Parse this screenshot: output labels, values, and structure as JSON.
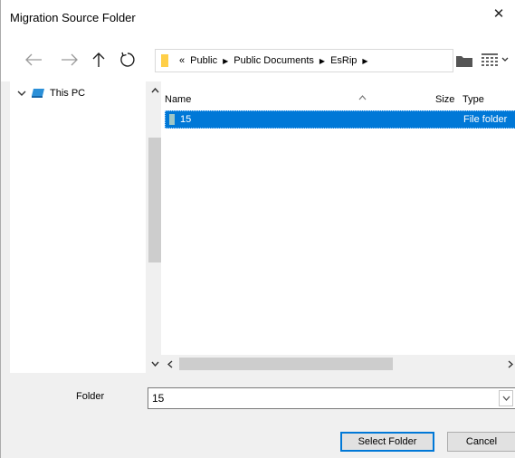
{
  "window": {
    "title": "Migration Source Folder",
    "close_glyph": "✕"
  },
  "nav": {
    "back_icon": "arrow-left-icon",
    "forward_icon": "arrow-right-icon",
    "up_icon": "arrow-up-icon",
    "refresh_icon": "refresh-icon"
  },
  "address": {
    "overflow_glyph": "«",
    "crumbs": [
      "Public",
      "Public Documents",
      "EsRip"
    ],
    "separator": "▶"
  },
  "tree": {
    "items": [
      {
        "label": "This PC",
        "expanded": true
      }
    ]
  },
  "file_list": {
    "columns": {
      "name": "Name",
      "size": "Size",
      "type": "Type"
    },
    "rows": [
      {
        "name": "15",
        "size": "",
        "type": "File folder",
        "selected": true
      }
    ]
  },
  "folder_field": {
    "label": "Folder",
    "value": "15"
  },
  "buttons": {
    "select": "Select Folder",
    "cancel": "Cancel"
  },
  "colors": {
    "accent": "#0078d7",
    "folder_yellow": "#ffcf48",
    "scroll_thumb": "#cdcdcd"
  }
}
